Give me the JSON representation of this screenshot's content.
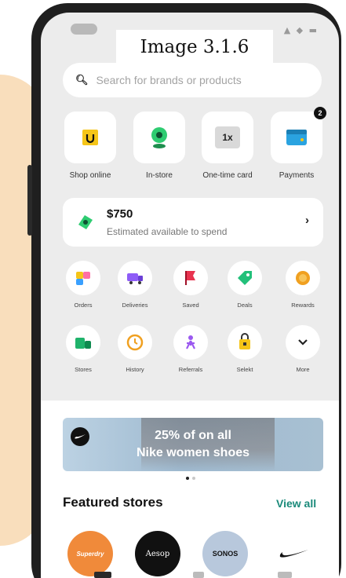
{
  "caption": "Image 3.1.6",
  "search": {
    "placeholder": "Search for brands or products"
  },
  "quick_actions": [
    {
      "label": "Shop online",
      "icon": "shopping-bag-icon"
    },
    {
      "label": "In-store",
      "icon": "store-pin-icon"
    },
    {
      "label": "One-time card",
      "icon": "card-icon",
      "card_text": "1x"
    },
    {
      "label": "Payments",
      "icon": "wallet-icon"
    }
  ],
  "payments_badge": "2",
  "spend": {
    "amount": "$750",
    "subtitle": "Estimated available to spend"
  },
  "shortcuts_row1": [
    {
      "label": "Orders",
      "icon": "orders-icon"
    },
    {
      "label": "Deliveries",
      "icon": "truck-icon"
    },
    {
      "label": "Saved",
      "icon": "flag-icon"
    },
    {
      "label": "Deals",
      "icon": "tag-icon"
    },
    {
      "label": "Rewards",
      "icon": "coin-icon"
    }
  ],
  "shortcuts_row2": [
    {
      "label": "Stores",
      "icon": "stores-icon"
    },
    {
      "label": "History",
      "icon": "clock-icon"
    },
    {
      "label": "Referrals",
      "icon": "person-icon"
    },
    {
      "label": "Selekt",
      "icon": "lock-bag-icon"
    },
    {
      "label": "More",
      "icon": "chevron-down-icon"
    }
  ],
  "banner": {
    "line1": "25% of on all",
    "line2": "Nike women shoes"
  },
  "featured": {
    "title": "Featured stores",
    "view_all": "View all"
  },
  "stores": [
    "Superdry",
    "Aesop",
    "SONOS",
    ""
  ],
  "colors": {
    "accent": "#1a8a7a",
    "screen_bg": "#ececec",
    "superdry": "#f08a3a",
    "sonos": "#b8c8dc"
  }
}
